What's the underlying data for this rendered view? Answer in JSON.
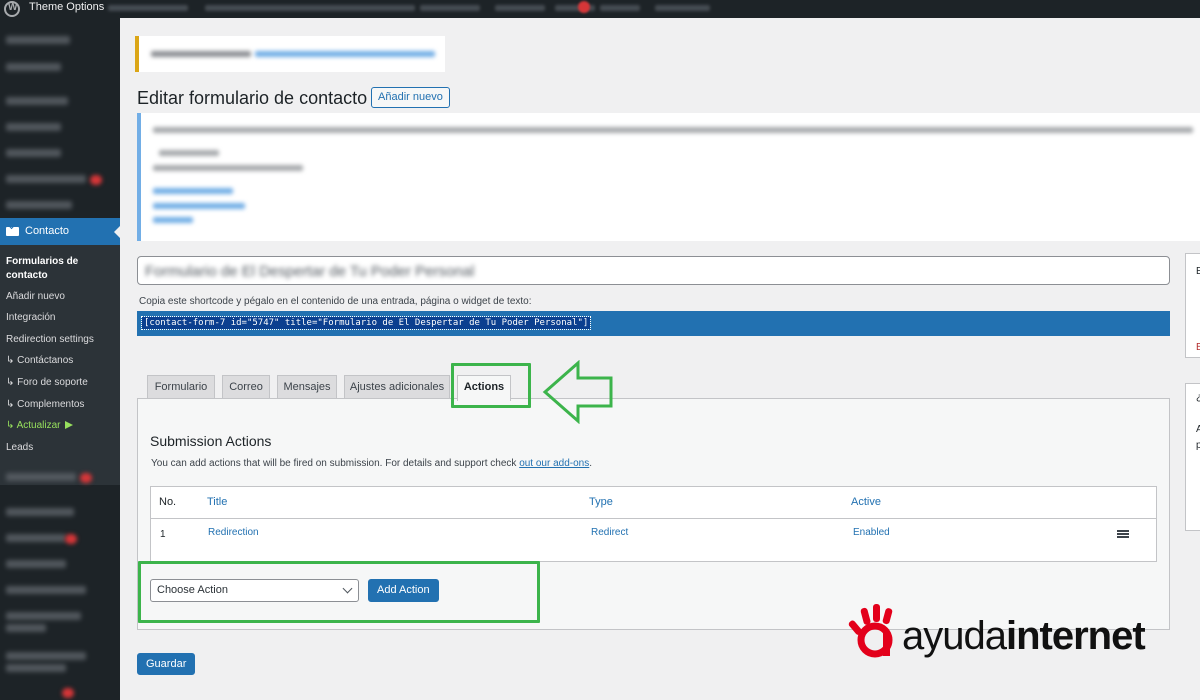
{
  "adminbar": {
    "title": "Theme Options"
  },
  "sidebar": {
    "active_label": "Contacto",
    "submenu": [
      {
        "label": "Formularios de contacto"
      },
      {
        "label": "Añadir nuevo"
      },
      {
        "label": "Integración"
      },
      {
        "label": "Redirection settings"
      },
      {
        "label": "↳ Contáctanos"
      },
      {
        "label": "↳ Foro de soporte"
      },
      {
        "label": "↳ Complementos"
      },
      {
        "label": "↳ Actualizar"
      },
      {
        "label": "Leads"
      }
    ]
  },
  "header": {
    "title": "Editar formulario de contacto",
    "add_new": "Añadir nuevo"
  },
  "form": {
    "title_value": "Formulario de El Despertar de Tu Poder Personal",
    "shortcode_desc": "Copia este shortcode y pégalo en el contenido de una entrada, página o widget de texto:",
    "shortcode": "[contact-form-7 id=\"5747\" title=\"Formulario de El Despertar de Tu Poder Personal\"]"
  },
  "tabs": [
    "Formulario",
    "Correo",
    "Mensajes",
    "Ajustes adicionales",
    "Actions"
  ],
  "actions": {
    "heading": "Submission Actions",
    "desc_prefix": "You can add actions that will be fired on submission. For details and support check ",
    "desc_link": "out our add-ons",
    "desc_suffix": ".",
    "columns": [
      "No.",
      "Title",
      "Type",
      "Active"
    ],
    "rows": [
      {
        "no": "1",
        "title": "Redirection",
        "type": "Redirect",
        "active": "Enabled"
      }
    ],
    "select_value": "Choose Action",
    "add_button": "Add Action"
  },
  "save_button": "Guardar",
  "right_letters": [
    "E",
    "B",
    "¿",
    "A",
    "p"
  ],
  "logo": {
    "part1": "ayuda",
    "part2": "internet"
  },
  "colors": {
    "primary": "#2271b1",
    "highlight": "#3cb44b",
    "sidebar": "#1d2327",
    "brand_red": "#e3001b"
  }
}
